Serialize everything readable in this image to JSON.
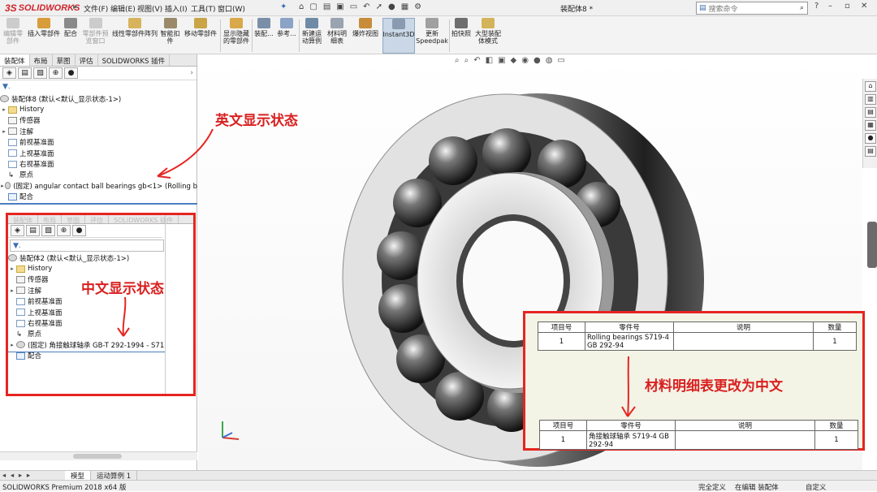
{
  "app": {
    "brand": "SOLIDWORKS",
    "logo_prefix": "3S",
    "doc_title": "装配体8 *"
  },
  "menu": [
    "文件(F)",
    "编辑(E)",
    "视图(V)",
    "插入(I)",
    "工具(T)",
    "窗口(W)"
  ],
  "menu_arrow": "►",
  "search": {
    "placeholder": "搜索命令"
  },
  "window_controls": {
    "help": "?",
    "minimize": "–",
    "restore": "▫",
    "close": "✕"
  },
  "toolbar": [
    {
      "label": "编辑零\n部件",
      "disabled": true
    },
    {
      "label": "插入零部件",
      "disabled": false
    },
    {
      "label": "配合",
      "disabled": false
    },
    {
      "label": "零部件预\n览窗口",
      "disabled": true
    },
    {
      "label": "线性零部件阵列",
      "disabled": false
    },
    {
      "label": "智能扣\n件",
      "disabled": false
    },
    {
      "label": "移动零部件",
      "disabled": false
    },
    {
      "label": "显示隐藏\n的零部件",
      "disabled": false
    },
    {
      "label": "装配...",
      "disabled": false
    },
    {
      "label": "参考...",
      "disabled": false
    },
    {
      "label": "新建运\n动算例",
      "disabled": false
    },
    {
      "label": "材料明\n细表",
      "disabled": false
    },
    {
      "label": "爆炸视图",
      "disabled": false
    },
    {
      "label": "Instant3D",
      "disabled": false
    },
    {
      "label": "更新\nSpeedpak",
      "disabled": false
    },
    {
      "label": "拍快照",
      "disabled": false
    },
    {
      "label": "大型装配\n体模式",
      "disabled": false
    }
  ],
  "panel_tabs": [
    "装配体",
    "布局",
    "草图",
    "评估",
    "SOLIDWORKS 插件"
  ],
  "filter_symbol": "▼.",
  "tree_en": {
    "root": "装配体8 (默认<默认_显示状态-1>)",
    "items": [
      "History",
      "传感器",
      "注解",
      "前视基准面",
      "上视基准面",
      "右视基准面",
      "原点",
      "(固定) angular contact ball bearings gb<1> (Rolling b",
      "配合"
    ]
  },
  "tree_zh": {
    "root": "装配体2 (默认<默认_显示状态-1>)",
    "items": [
      "History",
      "传感器",
      "注解",
      "前视基准面",
      "上视基准面",
      "右视基准面",
      "原点",
      "(固定) 角接触球轴承 GB-T 292-1994 - S71",
      "配合"
    ]
  },
  "annotations": {
    "english_state": "英文显示状态",
    "chinese_state": "中文显示状态",
    "bom_change": "材料明细表更改为中文"
  },
  "bom_headers": [
    "项目号",
    "零件号",
    "说明",
    "数量"
  ],
  "bom_en_row": {
    "item": "1",
    "part": "Rolling bearings S719-4 GB 292-94",
    "desc": "",
    "qty": "1"
  },
  "bom_zh_row": {
    "item": "1",
    "part": "角接触球轴承 S719-4 GB 292-94",
    "desc": "",
    "qty": "1"
  },
  "bottom_tabs": [
    "模型",
    "运动算例 1"
  ],
  "status": {
    "product": "SOLIDWORKS Premium 2018 x64 版",
    "defined": "完全定义",
    "mode": "在编辑 装配体",
    "units": "自定义"
  },
  "colors": {
    "annotation_red": "#e52521",
    "brand_red": "#d0252c",
    "tree_divider": "#4a7fbf"
  }
}
